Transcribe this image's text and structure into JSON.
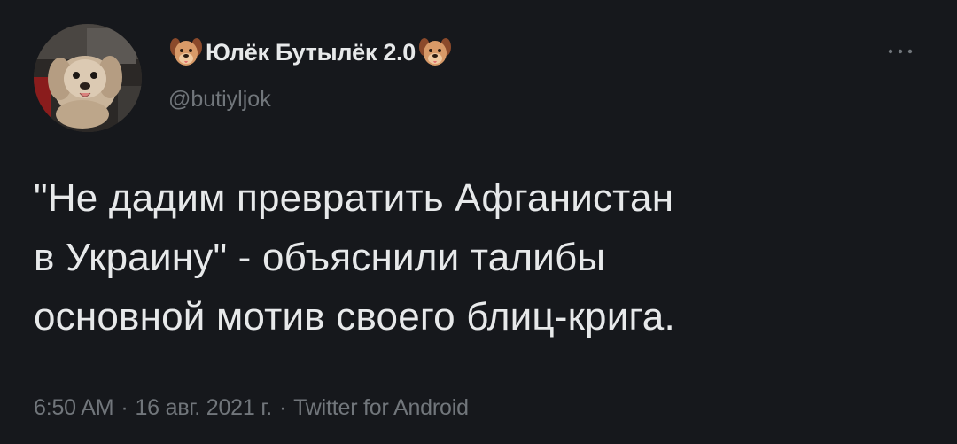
{
  "tweet": {
    "author": {
      "display_name": "Юлёк Бутылёк 2.0",
      "handle": "@butiyljok",
      "name_emoji": "dog-face-icon"
    },
    "more_icon": "more-icon",
    "text_lines": [
      "\"Не дадим превратить Афганистан",
      "в Украину\" - объяснили талибы",
      "основной мотив своего блиц-крига."
    ],
    "time": "6:50 AM",
    "date": "16 авг. 2021 г.",
    "separator": "·",
    "source": "Twitter for Android"
  },
  "colors": {
    "background": "#16181c",
    "text": "#e7e9ea",
    "secondary_text": "#71767b"
  }
}
